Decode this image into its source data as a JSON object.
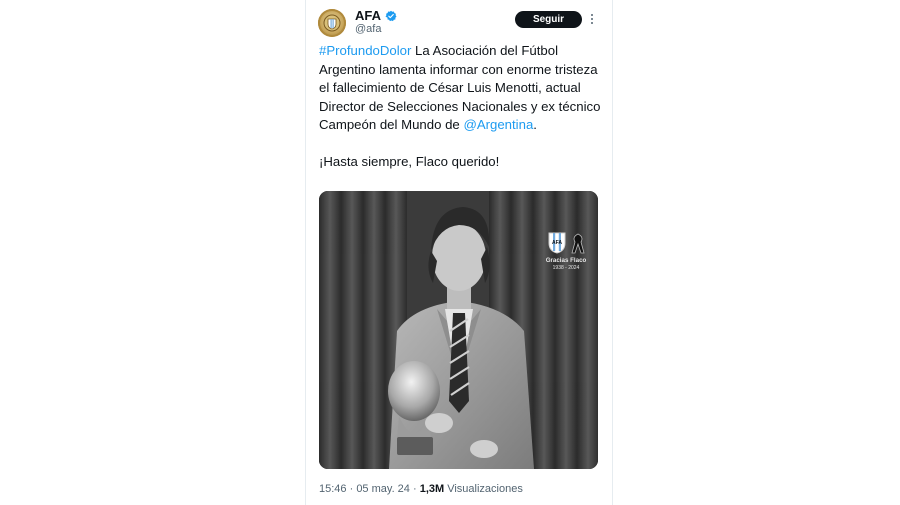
{
  "tweet": {
    "author_name": "AFA",
    "author_handle": "@afa",
    "follow_label": "Seguir",
    "hashtag": "#ProfundoDolor",
    "body_part1": " La Asociación del Fútbol Argentino lamenta informar con enorme tristeza el fallecimiento de César Luis Menotti, actual Director de Selecciones Nacionales y ex técnico Campeón del Mundo de ",
    "mention": "@Argentina",
    "body_part2": ".\n\n¡Hasta siempre, Flaco querido!",
    "image_overlay": {
      "caption": "Gracias Flaco",
      "years": "1938 - 2024"
    },
    "time": "15:46",
    "separator": " · ",
    "date": "05 may. 24",
    "views_count": "1,3M",
    "views_label": " Visualizaciones"
  },
  "colors": {
    "link": "#1d9bf0",
    "verified": "#1d9bf0",
    "button_bg": "#0f1419",
    "muted": "#536471"
  },
  "icons": [
    "afa-crest-icon",
    "verified-badge-icon",
    "more-options-icon",
    "afa-shield-icon",
    "mourning-ribbon-icon"
  ]
}
